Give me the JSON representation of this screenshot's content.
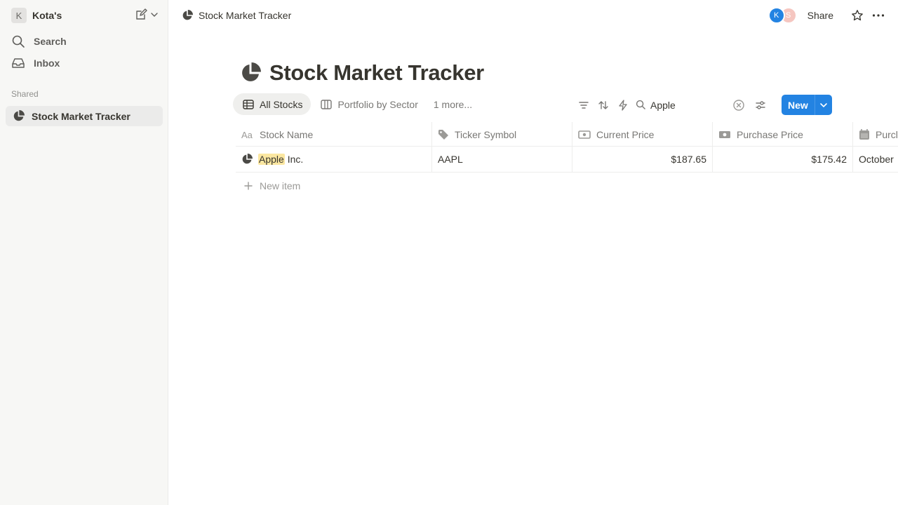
{
  "sidebar": {
    "workspace_initial": "K",
    "workspace_name": "Kota's",
    "items": [
      {
        "label": "Search",
        "icon": "search-icon"
      },
      {
        "label": "Inbox",
        "icon": "inbox-icon"
      }
    ],
    "section_label": "Shared",
    "pages": [
      {
        "label": "Stock Market Tracker",
        "icon": "pie-chart-icon"
      }
    ]
  },
  "topbar": {
    "breadcrumb": "Stock Market Tracker",
    "avatars": [
      "K",
      "S"
    ],
    "share_label": "Share"
  },
  "page": {
    "title": "Stock Market Tracker",
    "views": [
      {
        "label": "All Stocks",
        "icon": "table-icon",
        "active": true
      },
      {
        "label": "Portfolio by Sector",
        "icon": "board-icon",
        "active": false
      }
    ],
    "more_views": "1 more...",
    "search_value": "Apple",
    "new_label": "New"
  },
  "table": {
    "columns": [
      {
        "label": "Stock Name",
        "icon": "text-icon"
      },
      {
        "label": "Ticker Symbol",
        "icon": "tag-icon"
      },
      {
        "label": "Current Price",
        "icon": "currency-icon"
      },
      {
        "label": "Purchase Price",
        "icon": "money-icon"
      },
      {
        "label": "Purcl",
        "icon": "calendar-icon"
      }
    ],
    "rows": [
      {
        "name_highlight": "Apple",
        "name_rest": " Inc.",
        "ticker": "AAPL",
        "current_price": "$187.65",
        "purchase_price": "$175.42",
        "purchase_date": "October"
      }
    ],
    "new_item_label": "New item"
  },
  "colors": {
    "accent": "#2383e2",
    "highlight": "#fbe7a1",
    "sidebar_bg": "#f7f7f5"
  }
}
